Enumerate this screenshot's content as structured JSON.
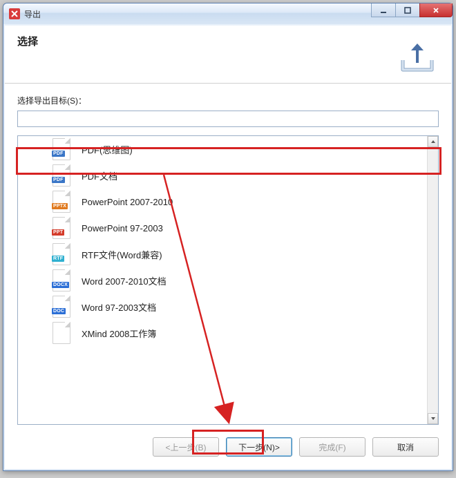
{
  "window": {
    "title": "导出"
  },
  "header": {
    "title": "选择"
  },
  "field_label": "选择导出目标(S)：",
  "search_value": "",
  "items": [
    {
      "badge": "PDF",
      "badge_class": "badge-pdf",
      "label": "PDF(思维图)",
      "selected": true
    },
    {
      "badge": "PDF",
      "badge_class": "badge-pdf",
      "label": "PDF文档"
    },
    {
      "badge": "PPTX",
      "badge_class": "badge-pptx",
      "label": "PowerPoint 2007-2010"
    },
    {
      "badge": "PPT",
      "badge_class": "badge-ppt",
      "label": "PowerPoint 97-2003"
    },
    {
      "badge": "RTF",
      "badge_class": "badge-rtf",
      "label": "RTF文件(Word兼容)"
    },
    {
      "badge": "DOCX",
      "badge_class": "badge-docx",
      "label": "Word 2007-2010文档"
    },
    {
      "badge": "DOC",
      "badge_class": "badge-doc",
      "label": "Word 97-2003文档"
    },
    {
      "badge": "",
      "badge_class": "badge-xmind",
      "label": "XMind 2008工作簿"
    }
  ],
  "buttons": {
    "back": "<上一步(B)",
    "next": "下一步(N)>",
    "finish": "完成(F)",
    "cancel": "取消"
  }
}
